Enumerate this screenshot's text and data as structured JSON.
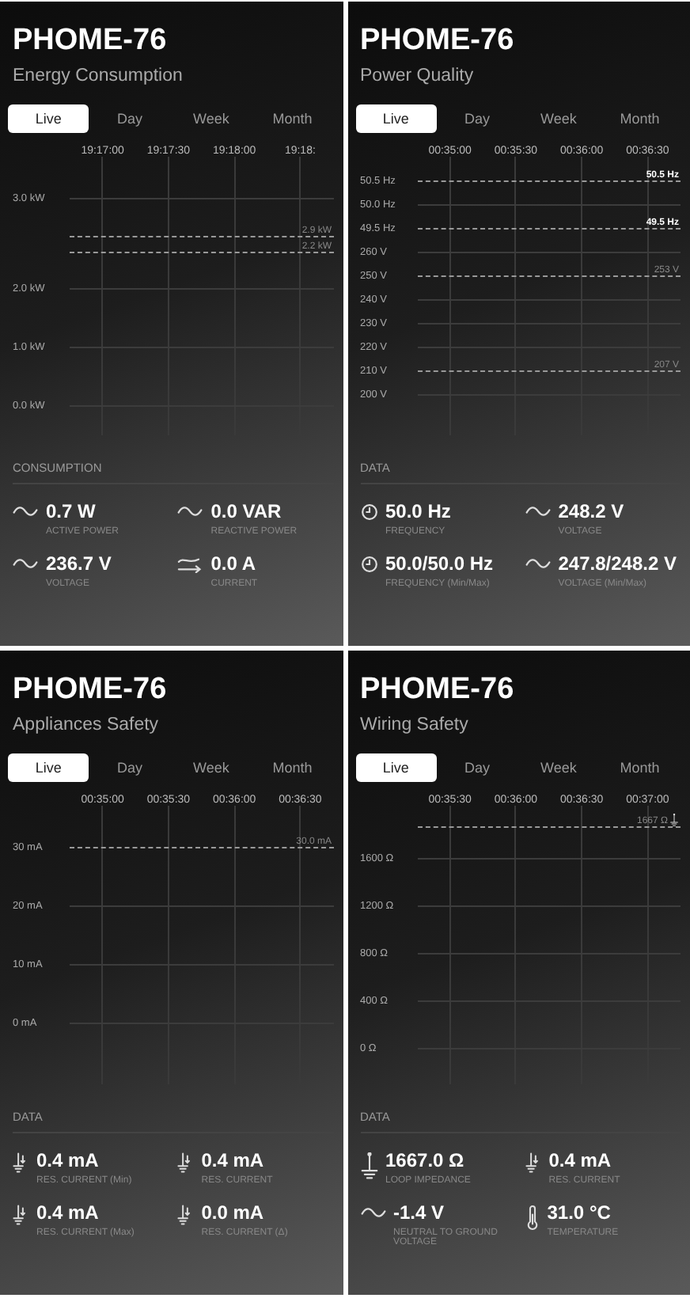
{
  "panels": [
    {
      "device": "PHOME-76",
      "title": "Energy Consumption",
      "tabs": [
        {
          "label": "Live",
          "selected": true
        },
        {
          "label": "Day",
          "selected": false
        },
        {
          "label": "Week",
          "selected": false
        },
        {
          "label": "Month",
          "selected": false
        }
      ],
      "chart": {
        "x_labels": [
          "19:17:00",
          "19:17:30",
          "19:18:00",
          "19:18:"
        ],
        "lines": [
          {
            "tick": "3.0 kW"
          },
          {
            "limit": "2.9 kW",
            "highlighted": false
          },
          {
            "limit": "2.2 kW",
            "highlighted": false
          },
          {
            "tick": "2.0 kW"
          },
          {
            "tick": "1.0 kW"
          },
          {
            "tick": "0.0 kW"
          }
        ]
      },
      "section": "CONSUMPTION",
      "readings": [
        {
          "kind": "wave",
          "value": "0.7 W",
          "label": "ACTIVE POWER"
        },
        {
          "kind": "wave",
          "value": "0.0 VAR",
          "label": "REACTIVE POWER"
        },
        {
          "kind": "wave",
          "value": "236.7 V",
          "label": "VOLTAGE"
        },
        {
          "kind": "current",
          "value": "0.0 A",
          "label": "CURRENT"
        }
      ]
    },
    {
      "device": "PHOME-76",
      "title": "Power Quality",
      "tabs": [
        {
          "label": "Live",
          "selected": true
        },
        {
          "label": "Day",
          "selected": false
        },
        {
          "label": "Week",
          "selected": false
        },
        {
          "label": "Month",
          "selected": false
        }
      ],
      "chart": {
        "x_labels": [
          "00:35:00",
          "00:35:30",
          "00:36:00",
          "00:36:30"
        ],
        "lines": [
          {
            "tick": "50.5 Hz",
            "limit": "50.5 Hz",
            "highlighted": true
          },
          {
            "tick": "50.0 Hz"
          },
          {
            "tick": "49.5 Hz",
            "limit": "49.5 Hz",
            "highlighted": true
          },
          {
            "tick": "260 V"
          },
          {
            "tick": "250 V",
            "limit": "253 V",
            "highlighted": false
          },
          {
            "tick": "240 V"
          },
          {
            "tick": "230 V"
          },
          {
            "tick": "220 V"
          },
          {
            "tick": "210 V",
            "limit": "207 V",
            "highlighted": false
          },
          {
            "tick": "200 V"
          }
        ]
      },
      "section": "DATA",
      "readings": [
        {
          "kind": "clock",
          "value": "50.0 Hz",
          "label": "FREQUENCY"
        },
        {
          "kind": "wave",
          "value": "248.2 V",
          "label": "VOLTAGE"
        },
        {
          "kind": "clock",
          "value": "50.0/50.0 Hz",
          "label": "FREQUENCY (Min/Max)"
        },
        {
          "kind": "wave",
          "value": "247.8/248.2 V",
          "label": "VOLTAGE (Min/Max)"
        }
      ]
    },
    {
      "device": "PHOME-76",
      "title": "Appliances Safety",
      "tabs": [
        {
          "label": "Live",
          "selected": true
        },
        {
          "label": "Day",
          "selected": false
        },
        {
          "label": "Week",
          "selected": false
        },
        {
          "label": "Month",
          "selected": false
        }
      ],
      "chart": {
        "x_labels": [
          "00:35:00",
          "00:35:30",
          "00:36:00",
          "00:36:30"
        ],
        "lines": [
          {
            "tick": "30 mA",
            "limit": "30.0 mA",
            "highlighted": false
          },
          {
            "tick": "20 mA"
          },
          {
            "tick": "10 mA"
          },
          {
            "tick": "0 mA"
          }
        ]
      },
      "section": "DATA",
      "readings": [
        {
          "kind": "ground-current",
          "value": "0.4 mA",
          "label": "RES. CURRENT (Min)"
        },
        {
          "kind": "ground-current",
          "value": "0.4 mA",
          "label": "RES. CURRENT"
        },
        {
          "kind": "ground-current",
          "value": "0.4 mA",
          "label": "RES. CURRENT (Max)"
        },
        {
          "kind": "ground-current",
          "value": "0.0 mA",
          "label": "RES. CURRENT (Δ)"
        }
      ]
    },
    {
      "device": "PHOME-76",
      "title": "Wiring Safety",
      "tabs": [
        {
          "label": "Live",
          "selected": true
        },
        {
          "label": "Day",
          "selected": false
        },
        {
          "label": "Week",
          "selected": false
        },
        {
          "label": "Month",
          "selected": false
        }
      ],
      "chart": {
        "x_labels": [
          "00:35:30",
          "00:36:00",
          "00:36:30",
          "00:37:00"
        ],
        "lines": [
          {
            "limit": "1667 Ω",
            "highlighted": false,
            "kind": "marked"
          },
          {
            "tick": "1600 Ω"
          },
          {
            "tick": "1200 Ω"
          },
          {
            "tick": "800 Ω"
          },
          {
            "tick": "400 Ω"
          },
          {
            "tick": "0 Ω"
          }
        ]
      },
      "section": "DATA",
      "readings": [
        {
          "kind": "ground",
          "value": "1667.0 Ω",
          "label": "LOOP IMPEDANCE"
        },
        {
          "kind": "ground-current",
          "value": "0.4 mA",
          "label": "RES. CURRENT"
        },
        {
          "kind": "wave",
          "value": "-1.4 V",
          "label": "NEUTRAL TO GROUND VOLTAGE"
        },
        {
          "kind": "thermometer",
          "value": "31.0 °C",
          "label": "TEMPERATURE"
        }
      ]
    }
  ]
}
